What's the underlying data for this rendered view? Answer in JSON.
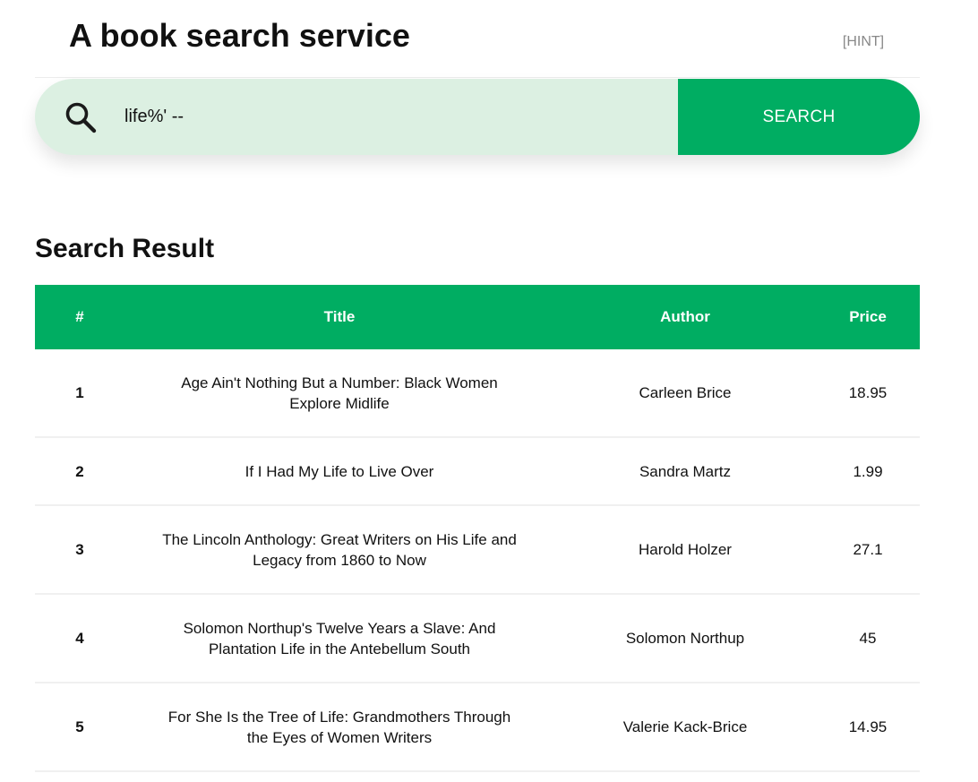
{
  "header": {
    "title": "A book search service",
    "hint_label": "[HINT]"
  },
  "search": {
    "value": "life%' --",
    "button_label": "SEARCH",
    "icon": "search-icon"
  },
  "results": {
    "heading": "Search Result",
    "columns": [
      "#",
      "Title",
      "Author",
      "Price"
    ],
    "rows": [
      {
        "num": "1",
        "title": "Age Ain't Nothing But a Number: Black Women Explore Midlife",
        "author": "Carleen Brice",
        "price": "18.95"
      },
      {
        "num": "2",
        "title": "If I Had My Life to Live Over",
        "author": "Sandra Martz",
        "price": "1.99"
      },
      {
        "num": "3",
        "title": "The Lincoln Anthology: Great Writers on His Life and Legacy from 1860 to Now",
        "author": "Harold Holzer",
        "price": "27.1"
      },
      {
        "num": "4",
        "title": "Solomon Northup's Twelve Years a Slave: And Plantation Life in the Antebellum South",
        "author": "Solomon Northup",
        "price": "45"
      },
      {
        "num": "5",
        "title": "For She Is the Tree of Life: Grandmothers Through the Eyes of Women Writers",
        "author": "Valerie Kack-Brice",
        "price": "14.95"
      }
    ]
  },
  "colors": {
    "accent": "#00ad62",
    "search_bg": "#dcf0e2",
    "hint": "#888888"
  }
}
